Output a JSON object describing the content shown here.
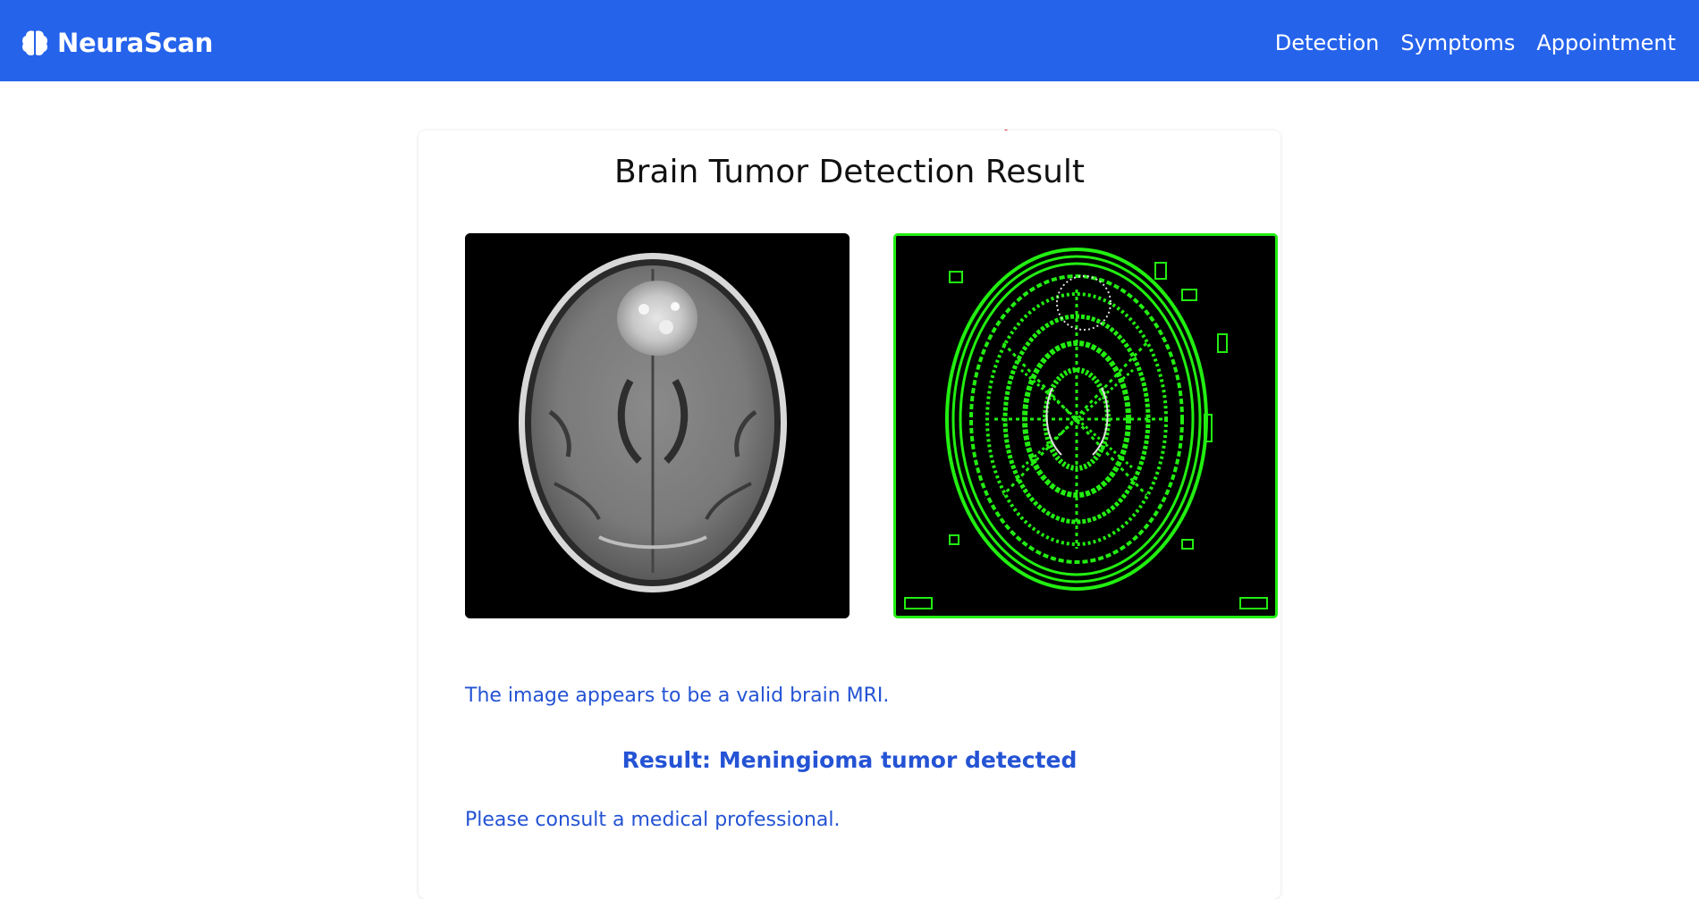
{
  "navbar": {
    "brand": "NeuraScan",
    "brand_icon": "brain-icon",
    "links": [
      {
        "label": "Detection"
      },
      {
        "label": "Symptoms"
      },
      {
        "label": "Appointment"
      }
    ],
    "background_color": "#2563eb"
  },
  "main": {
    "title": "Brain Tumor Detection Result",
    "images": {
      "original": "mri-scan-image",
      "processed": "edge-detection-image"
    },
    "validation_message": "The image appears to be a valid brain MRI.",
    "result": "Result: Meningioma tumor detected",
    "advice": "Please consult a medical professional.",
    "accent_color": "#2453d4",
    "highlight_color": "#22ee11"
  }
}
